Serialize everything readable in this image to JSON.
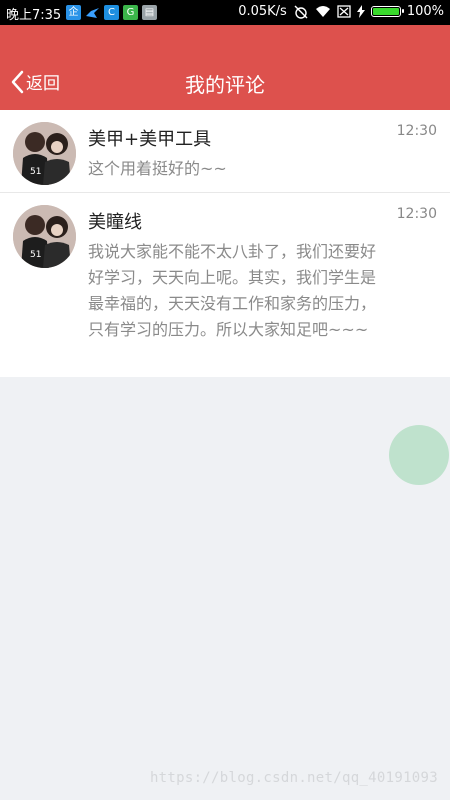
{
  "status_bar": {
    "time": "晚上7:35",
    "speed": "0.05K/s",
    "battery": "100%",
    "battery_level": 1.0,
    "app_icons": [
      "qq-icon",
      "bird-icon",
      "c-app-icon",
      "grid-app-icon",
      "square-app-icon"
    ]
  },
  "appbar": {
    "back_label": "返回",
    "title": "我的评论",
    "color": "#dd514d"
  },
  "comments": [
    {
      "name": "美甲+美甲工具",
      "time": "12:30",
      "text": "这个用着挺好的~~"
    },
    {
      "name": "美瞳线",
      "time": "12:30",
      "text": "我说大家能不能不太八卦了，我们还要好好学习，天天向上呢。其实，我们学生是最幸福的，天天没有工作和家务的压力，只有学习的压力。所以大家知足吧~~~"
    }
  ],
  "watermark": "https://blog.csdn.net/qq_40191093"
}
